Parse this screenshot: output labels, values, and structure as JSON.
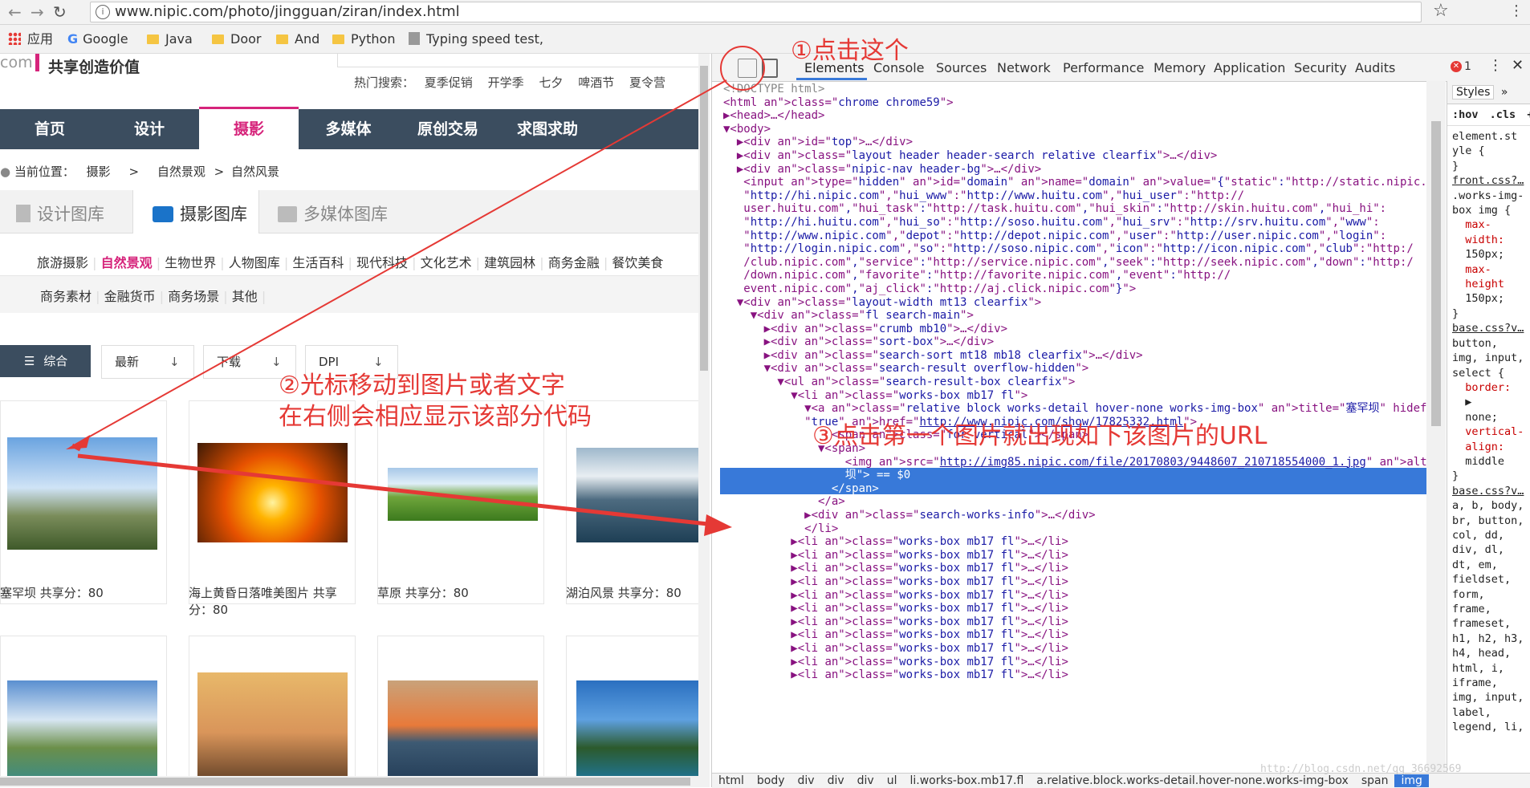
{
  "browser": {
    "url": "www.nipic.com/photo/jingguan/ziran/index.html",
    "bookmarks": [
      "应用",
      "Google",
      "Java",
      "Door",
      "And",
      "Python",
      "Typing speed test, c"
    ]
  },
  "site": {
    "slogan": "共享创造价值",
    "logo_partial": "com",
    "hot_search_label": "热门搜索：",
    "hot_searches": [
      "夏季促销",
      "开学季",
      "七夕",
      "啤酒节",
      "夏令营"
    ],
    "nav": [
      "首页",
      "设计",
      "摄影",
      "多媒体",
      "原创交易",
      "求图求助"
    ],
    "breadcrumb": [
      "当前位置：",
      "摄影",
      ">",
      "自然景观",
      ">",
      "自然风景"
    ],
    "libraries": [
      "设计图库",
      "摄影图库",
      "多媒体图库"
    ],
    "categories_row1": [
      "旅游摄影",
      "自然景观",
      "生物世界",
      "人物图库",
      "生活百科",
      "现代科技",
      "文化艺术",
      "建筑园林",
      "商务金融",
      "餐饮美食"
    ],
    "categories_row2": [
      "商务素材",
      "金融货币",
      "商务场景",
      "其他"
    ],
    "sort_buttons": [
      "综合",
      "最新",
      "下载",
      "DPI"
    ],
    "captions": [
      "塞罕坝 共享分：80",
      "海上黄昏日落唯美图片 共享",
      "分：80",
      "草原 共享分：80",
      "湖泊风景 共享分：80"
    ]
  },
  "devtools": {
    "tabs": [
      "Elements",
      "Console",
      "Sources",
      "Network",
      "Performance",
      "Memory",
      "Application",
      "Security",
      "Audits"
    ],
    "error_count": "1",
    "styles_tabs": [
      "Styles",
      "»"
    ],
    "styles_filter": [
      ":hov",
      ".cls",
      "+"
    ],
    "code_lines": [
      "<!DOCTYPE html>",
      "<html class=\"chrome chrome59\">",
      "▶<head>…</head>",
      "▼<body>",
      "  ▶<div id=\"top\">…</div>",
      "  ▶<div class=\"layout header header-search relative clearfix\">…</div>",
      "  ▶<div class=\"nipic-nav header-bg\">…</div>",
      "   <input type=\"hidden\" id=\"domain\" name=\"domain\" value=\"{\"static\":\"http://static.nipic.com\",\"hi\":",
      "   \"http://hi.nipic.com\",\"hui_www\":\"http://www.huitu.com\",\"hui_user\":\"http://",
      "   user.huitu.com\",\"hui_task\":\"http://task.huitu.com\",\"hui_skin\":\"http://skin.huitu.com\",\"hui_hi\":",
      "   \"http://hi.huitu.com\",\"hui_so\":\"http://soso.huitu.com\",\"hui_srv\":\"http://srv.huitu.com\",\"www\":",
      "   \"http://www.nipic.com\",\"depot\":\"http://depot.nipic.com\",\"user\":\"http://user.nipic.com\",\"login\":",
      "   \"http://login.nipic.com\",\"so\":\"http://soso.nipic.com\",\"icon\":\"http://icon.nipic.com\",\"club\":\"http:/",
      "   /club.nipic.com\",\"service\":\"http://service.nipic.com\",\"seek\":\"http://seek.nipic.com\",\"down\":\"http:/",
      "   /down.nipic.com\",\"favorite\":\"http://favorite.nipic.com\",\"event\":\"http://",
      "   event.nipic.com\",\"aj_click\":\"http://aj.click.nipic.com\"}\">",
      "  ▼<div class=\"layout-width mt13 clearfix\">",
      "    ▼<div class=\"fl search-main\">",
      "      ▶<div class=\"crumb mb10\">…</div>",
      "      ▶<div class=\"sort-box\">…</div>",
      "      ▶<div class=\"search-sort mt18 mb18 clearfix\">…</div>",
      "      ▼<div class=\"search-result overflow-hidden\">",
      "        ▼<ul class=\"search-result-box clearfix\">",
      "          ▼<li class=\"works-box mb17 fl\">",
      "            ▼<a class=\"relative block works-detail hover-none works-img-box\" title=\"塞罕坝\" hidefocus=",
      "            \"true\" href=\"http://www.nipic.com/show/17825332.html\">",
      "                <span class=\"for-vertical\"></span>",
      "              ▼<span>",
      "                  <img src=\"http://img85.nipic.com/file/20170803/9448607_210718554000_1.jpg\" alt=\"塞罕",
      "                  坝\"> == $0",
      "                </span>",
      "              </a>",
      "            ▶<div class=\"search-works-info\">…</div>",
      "            </li>",
      "          ▶<li class=\"works-box mb17 fl\">…</li>",
      "          ▶<li class=\"works-box mb17 fl\">…</li>",
      "          ▶<li class=\"works-box mb17 fl\">…</li>",
      "          ▶<li class=\"works-box mb17 fl\">…</li>",
      "          ▶<li class=\"works-box mb17 fl\">…</li>",
      "          ▶<li class=\"works-box mb17 fl\">…</li>",
      "          ▶<li class=\"works-box mb17 fl\">…</li>",
      "          ▶<li class=\"works-box mb17 fl\">…</li>",
      "          ▶<li class=\"works-box mb17 fl\">…</li>",
      "          ▶<li class=\"works-box mb17 fl\">…</li>",
      "          ▶<li class=\"works-box mb17 fl\">…</li>"
    ],
    "selected_line_index": 29,
    "styles_text": [
      "element.st",
      "yle {",
      "}",
      "front.css?…",
      ".works-img-",
      "box img {",
      "  max-",
      "  width:",
      "  150px;",
      "  max-",
      "  height",
      "  150px;",
      "}",
      "base.css?v…",
      "button,",
      "img, input,",
      "select {",
      "  border:",
      "  ▶",
      "  none;",
      "",
      "  vertical-",
      "  align:",
      "  middle",
      "}",
      "base.css?v…",
      "a, b, body,",
      "br, button,",
      "col, dd,",
      "div, dl,",
      "dt, em,",
      "fieldset,",
      "form,",
      "frame,",
      "frameset,",
      "h1, h2, h3,",
      "h4, head,",
      "html, i,",
      "iframe,",
      "img, input,",
      "label,",
      "legend, li,"
    ],
    "breadcrumbs": [
      "html",
      "body",
      "div",
      "div",
      "div",
      "ul",
      "li.works-box.mb17.fl",
      "a.relative.block.works-detail.hover-none.works-img-box",
      "span",
      "img"
    ]
  },
  "annotations": {
    "step1": "①点击这个",
    "step2a": "②光标移动到图片或者文字",
    "step2b": "在右侧会相应显示该部分代码",
    "step3": "③点击第一个图片就出现如下该图片的URL"
  },
  "watermark": "http://blog.csdn.net/qq_36692569",
  "colors": {
    "accent": "#d6247b",
    "nav_bg": "#3b4d5f",
    "annotation": "#e53935",
    "devtools_selected": "#3879d9"
  }
}
